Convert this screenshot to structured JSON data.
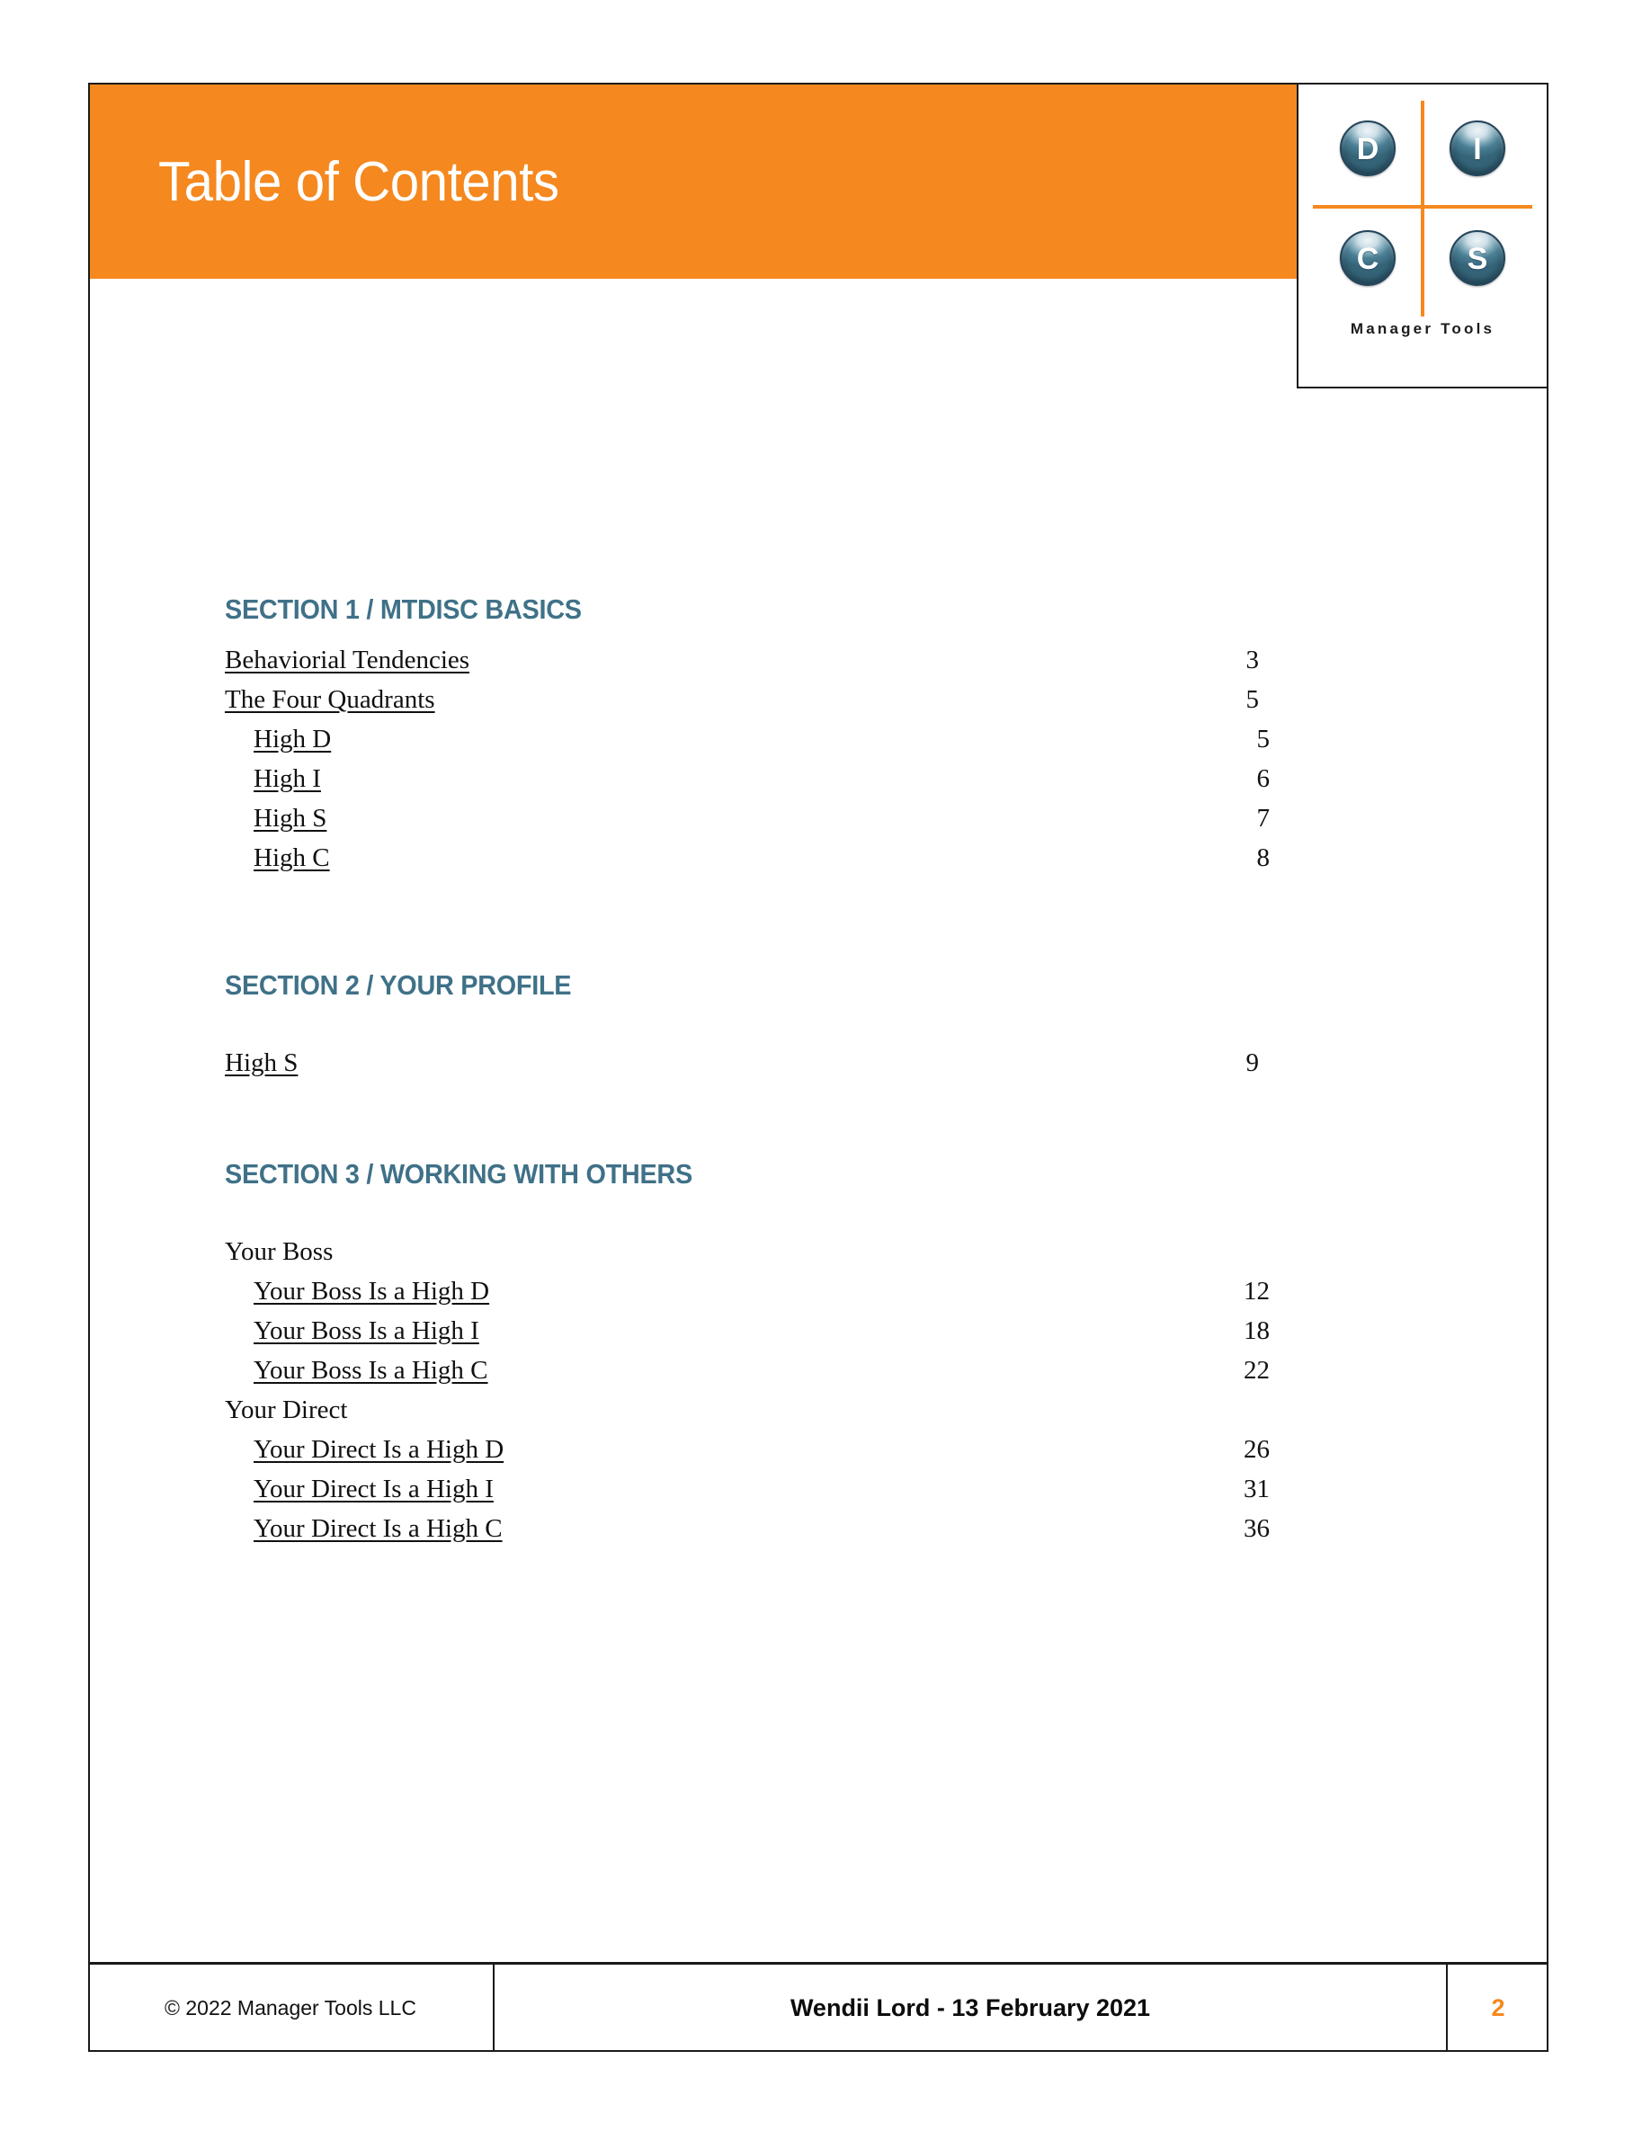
{
  "header": {
    "title": "Table of Contents",
    "bar_color": "#F5881E"
  },
  "logo": {
    "wordmark": "Manager Tools",
    "spheres": [
      {
        "letter": "D",
        "position": "top-left"
      },
      {
        "letter": "I",
        "position": "top-right"
      },
      {
        "letter": "C",
        "position": "bottom-left"
      },
      {
        "letter": "S",
        "position": "bottom-right"
      }
    ],
    "accent_color": "#F5881E",
    "sphere_color": "#4B7F94"
  },
  "theme": {
    "heading_color": "#3F7188",
    "accent_color": "#F5881E",
    "text_color": "#101010"
  },
  "toc": {
    "sections": [
      {
        "heading": "SECTION 1 / MTDISC BASICS",
        "entries": [
          {
            "label": "Behaviorial Tendencies",
            "page": "3",
            "level": 1,
            "linked": true
          },
          {
            "label": "The Four Quadrants",
            "page": "5",
            "level": 1,
            "linked": true
          },
          {
            "label": "High D",
            "page": "5",
            "level": 2,
            "linked": true
          },
          {
            "label": "High I",
            "page": "6",
            "level": 2,
            "linked": true
          },
          {
            "label": "High S",
            "page": "7",
            "level": 2,
            "linked": true
          },
          {
            "label": "High C",
            "page": "8",
            "level": 2,
            "linked": true
          }
        ]
      },
      {
        "heading": "SECTION 2 / YOUR PROFILE",
        "entries": [
          {
            "label": "High S",
            "page": "9",
            "level": 1,
            "linked": true
          }
        ]
      },
      {
        "heading": "SECTION 3 / WORKING WITH OTHERS",
        "entries": [
          {
            "label": "Your Boss",
            "page": "",
            "level": 1,
            "linked": false
          },
          {
            "label": "Your Boss Is a High D",
            "page": "12",
            "level": 2,
            "linked": true
          },
          {
            "label": "Your Boss Is a High I",
            "page": "18",
            "level": 2,
            "linked": true
          },
          {
            "label": "Your Boss Is a High C",
            "page": "22",
            "level": 2,
            "linked": true
          },
          {
            "label": "Your Direct",
            "page": "",
            "level": 1,
            "linked": false
          },
          {
            "label": "Your Direct Is a High D",
            "page": "26",
            "level": 2,
            "linked": true
          },
          {
            "label": "Your Direct Is a High I",
            "page": "31",
            "level": 2,
            "linked": true
          },
          {
            "label": "Your Direct Is a High C",
            "page": "36",
            "level": 2,
            "linked": true
          }
        ]
      }
    ]
  },
  "footer": {
    "copyright": "© 2022 Manager Tools LLC",
    "center": "Wendii Lord  -  13 February 2021",
    "page_number": "2"
  }
}
